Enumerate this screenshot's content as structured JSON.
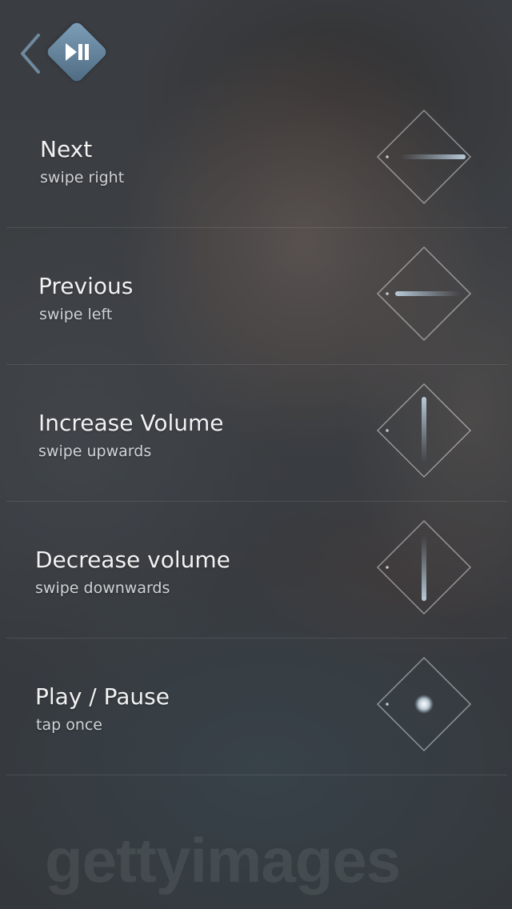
{
  "header": {
    "back_icon": "chevron-left-icon",
    "badge_icon": "play-pause-icon",
    "badge_color": "#6e8ca5"
  },
  "gestures": [
    {
      "title": "Next",
      "hint": "swipe right",
      "icon": "swipe-right-icon"
    },
    {
      "title": "Previous",
      "hint": "swipe left",
      "icon": "swipe-left-icon"
    },
    {
      "title": "Increase Volume",
      "hint": "swipe upwards",
      "icon": "swipe-up-icon"
    },
    {
      "title": "Decrease volume",
      "hint": "swipe downwards",
      "icon": "swipe-down-icon"
    },
    {
      "title": "Play / Pause",
      "hint": "tap once",
      "icon": "tap-icon"
    }
  ],
  "watermark": "gettyimages"
}
